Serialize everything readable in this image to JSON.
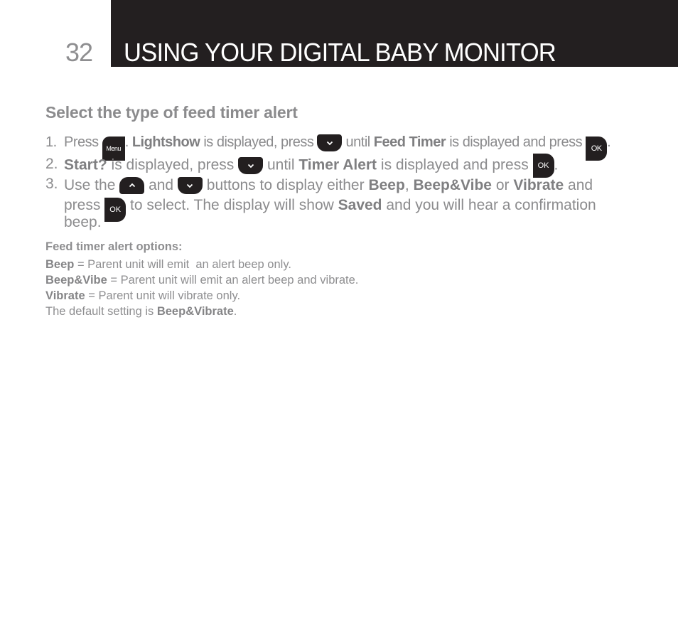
{
  "header": {
    "page_number": "32",
    "title": "USING YOUR DIGITAL BABY MONITOR",
    "bar_color": "#231f20"
  },
  "section": {
    "heading": "Select the type of feed timer alert"
  },
  "steps": [
    {
      "num": "1.",
      "t1": "Press",
      "btn_menu": "Menu",
      "t2": ".",
      "b1": "Lightshow",
      "t3": "is displayed, press",
      "t4": "until",
      "b2": "Feed Timer",
      "t5": "is displayed and press",
      "btn_ok": "OK",
      "t6": "."
    },
    {
      "num": "2.",
      "b1": "Start?",
      "t1": "is displayed, press",
      "t2": "until",
      "b2": "Timer Alert",
      "t3": "is displayed and press",
      "btn_ok": "OK",
      "t4": "."
    },
    {
      "num": "3.",
      "t1": "Use the",
      "t2": "and",
      "t3": "buttons to display either",
      "b1": "Beep",
      "t4": ",",
      "b2": "Beep&Vibe",
      "t5": "or",
      "b3": "Vibrate",
      "t6": "and",
      "t7": "press",
      "btn_ok": "OK",
      "t8": "to select. The display will show",
      "b4": "Saved",
      "t9": "and you will hear a confirmation",
      "t10": "beep."
    }
  ],
  "options": {
    "title": "Feed timer alert options:",
    "items": [
      {
        "term": "Beep",
        "desc": " = Parent unit will emit  an alert beep only."
      },
      {
        "term": "Beep&Vibe",
        "desc": " = Parent unit will emit an alert beep and vibrate."
      },
      {
        "term": "Vibrate",
        "desc": " = Parent unit will vibrate only."
      }
    ],
    "default_prefix": "The default setting is ",
    "default_value": "Beep&Vibrate",
    "default_suffix": "."
  },
  "icons": {
    "menu": "menu-button-icon",
    "down": "down-arrow-button-icon",
    "up": "up-arrow-button-icon",
    "ok": "ok-button-icon"
  }
}
